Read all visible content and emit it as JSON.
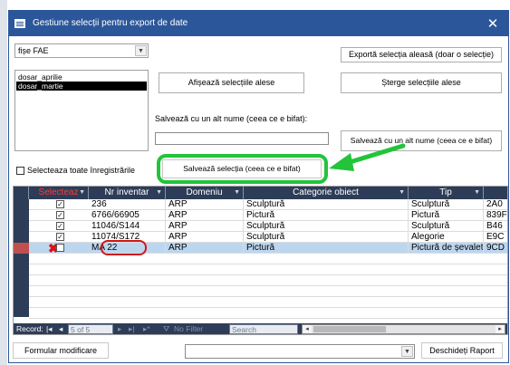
{
  "window": {
    "title": "Gestiune selecții pentru export de date",
    "close": "✕"
  },
  "combo": {
    "value": "fișe FAE"
  },
  "list": {
    "items": [
      "dosar_aprilie",
      "dosar_martie"
    ],
    "selected_index": 1
  },
  "buttons": {
    "export": "Exportă selecția aleasă (doar o selecție)",
    "show": "Afișează selecțiile alese",
    "delete": "Șterge selecțiile alese",
    "save_as": "Salvează cu un alt nume (ceea ce e bifat)",
    "save": "Salvează selecția (ceea ce e bifat)",
    "form_modify": "Formular modificare",
    "open_report": "Deschideți Raport"
  },
  "labels": {
    "save_as_prompt": "Salvează cu un alt nume (ceea ce e bifat):",
    "select_all": "Selecteaza toate înregistrările"
  },
  "grid": {
    "columns": [
      "Selecteaz",
      "Nr inventar",
      "Domeniu",
      "Categorie obiect",
      "Tip",
      ""
    ],
    "rows": [
      {
        "checked": true,
        "inv": "236",
        "dom": "ARP",
        "cat": "Sculptură",
        "tip": "Sculptură",
        "code": "2A0"
      },
      {
        "checked": true,
        "inv": "6766/66905",
        "dom": "ARP",
        "cat": "Pictură",
        "tip": "Pictură",
        "code": "839F"
      },
      {
        "checked": true,
        "inv": "11046/S144",
        "dom": "ARP",
        "cat": "Sculptură",
        "tip": "Sculptură",
        "code": "B46"
      },
      {
        "checked": true,
        "inv": "11074/S172",
        "dom": "ARP",
        "cat": "Sculptură",
        "tip": "Alegorie",
        "code": "E9C"
      },
      {
        "checked": false,
        "inv": "MA 22",
        "dom": "ARP",
        "cat": "Pictură",
        "tip": "Pictură de șevalet",
        "code": "9CD"
      }
    ],
    "active_row": 4
  },
  "navigator": {
    "record_label": "Record:",
    "position": "5 of 5",
    "filter": "No Filter",
    "search": "Search"
  },
  "colors": {
    "title_bar": "#2b579a",
    "grid_header": "#2e3d57",
    "highlight": "#22c43a",
    "annotation_red": "#d01818"
  }
}
